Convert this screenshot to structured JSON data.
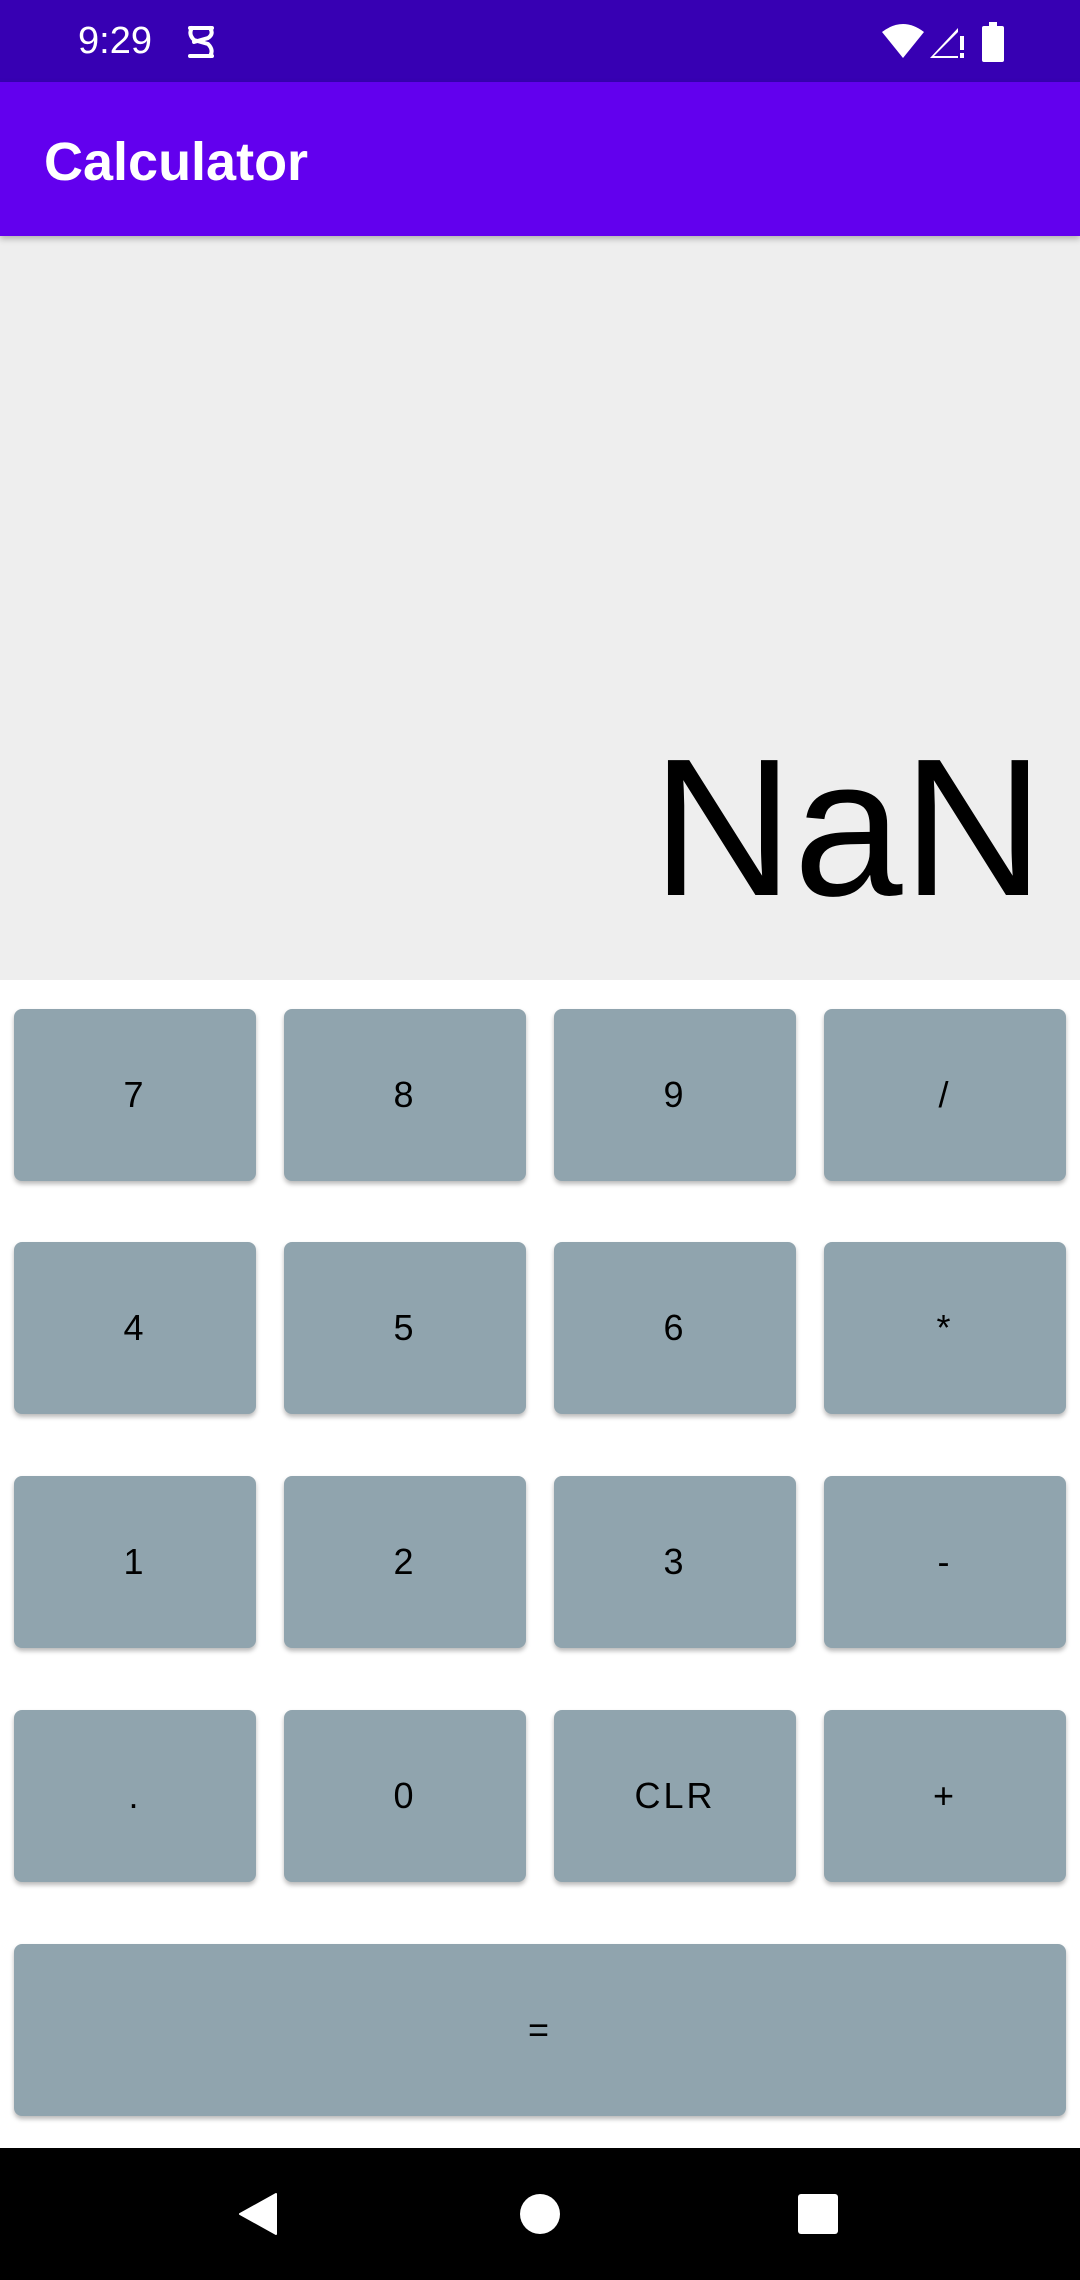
{
  "status_bar": {
    "time": "9:29",
    "icons": [
      "notification-icon",
      "wifi-icon",
      "signal-icon",
      "battery-icon"
    ]
  },
  "app_bar": {
    "title": "Calculator",
    "color": "#6200ee",
    "status_color": "#3700b3"
  },
  "display": {
    "value": "NaN",
    "background": "#eeeeee"
  },
  "keypad": {
    "color": "#90a4ae",
    "rows": [
      [
        "7",
        "8",
        "9",
        "/"
      ],
      [
        "4",
        "5",
        "6",
        "*"
      ],
      [
        "1",
        "2",
        "3",
        "-"
      ],
      [
        ".",
        "0",
        "CLR",
        "+"
      ]
    ],
    "equals": "="
  },
  "nav_bar": {
    "icons": [
      "back-icon",
      "home-icon",
      "recents-icon"
    ]
  }
}
